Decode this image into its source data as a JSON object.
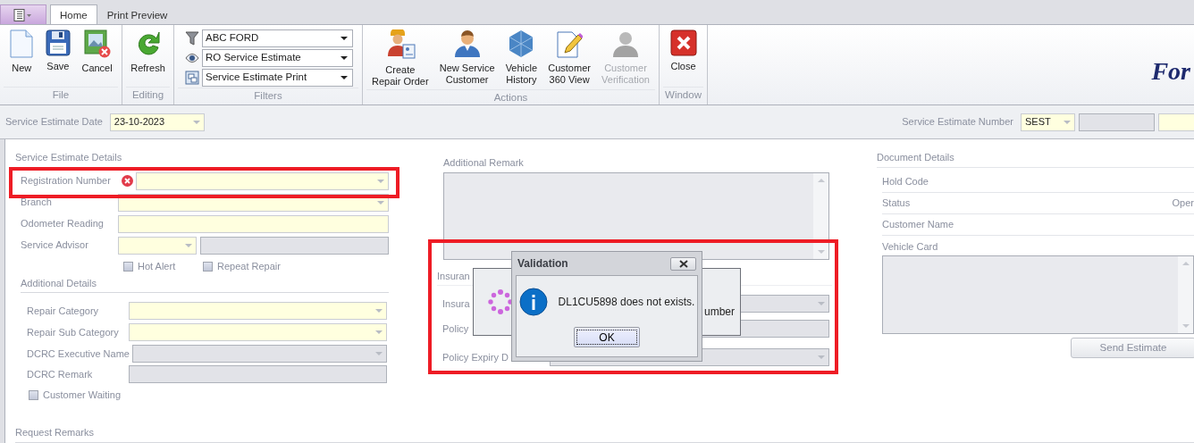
{
  "tabs": [
    {
      "label": "Home",
      "selected": true
    },
    {
      "label": "Print Preview",
      "selected": false
    }
  ],
  "ribbon": {
    "groups": [
      {
        "title": "File",
        "kind": "buttons",
        "buttons": [
          {
            "label": "New",
            "disabled": false
          },
          {
            "label": "Save",
            "disabled": false
          },
          {
            "label": "Cancel",
            "disabled": false
          }
        ]
      },
      {
        "title": "Editing",
        "kind": "buttons",
        "buttons": [
          {
            "label": "Refresh",
            "disabled": false
          }
        ]
      },
      {
        "title": "Filters",
        "kind": "filters",
        "dropdowns": [
          {
            "value": "ABC FORD"
          },
          {
            "value": "RO Service Estimate"
          },
          {
            "value": "Service Estimate Print"
          }
        ]
      },
      {
        "title": "Actions",
        "kind": "buttons",
        "buttons": [
          {
            "label": "Create\nRepair Order",
            "disabled": false
          },
          {
            "label": "New Service\nCustomer",
            "disabled": false
          },
          {
            "label": "Vehicle\nHistory",
            "disabled": false
          },
          {
            "label": "Customer\n360 View",
            "disabled": false
          },
          {
            "label": "Customer\nVerification",
            "disabled": true
          }
        ]
      },
      {
        "title": "Window",
        "kind": "buttons",
        "buttons": [
          {
            "label": "Close",
            "disabled": false
          }
        ]
      }
    ],
    "logo": "For"
  },
  "header_bar": {
    "date_label": "Service Estimate Date",
    "date_value": "23-10-2023",
    "number_label": "Service Estimate Number",
    "number_prefix": "SEST"
  },
  "service_estimate_details": {
    "title": "Service Estimate Details",
    "fields": [
      {
        "label": "Registration Number",
        "kind": "combo",
        "error": true,
        "disabled": false
      },
      {
        "label": "Branch",
        "kind": "combo",
        "error": false,
        "disabled": false
      },
      {
        "label": "Odometer Reading",
        "kind": "text",
        "error": false,
        "disabled": false
      },
      {
        "label": "Service Advisor",
        "kind": "combo_pair",
        "error": false,
        "disabled": false
      }
    ],
    "checkboxes": [
      {
        "label": "Hot Alert",
        "checked": false
      },
      {
        "label": "Repeat Repair",
        "checked": false
      }
    ]
  },
  "additional_details": {
    "title": "Additional Details",
    "fields": [
      {
        "label": "Repair Category",
        "kind": "combo",
        "error": false,
        "disabled": false
      },
      {
        "label": "Repair Sub Category",
        "kind": "combo",
        "error": false,
        "disabled": false
      },
      {
        "label": "DCRC Executive Name",
        "kind": "combo",
        "error": false,
        "disabled": true
      },
      {
        "label": "DCRC Remark",
        "kind": "text",
        "error": false,
        "disabled": true
      }
    ],
    "checkboxes": [
      {
        "label": "Customer Waiting",
        "checked": false
      }
    ]
  },
  "request_remarks": {
    "title": "Request Remarks"
  },
  "additional_remark": {
    "title": "Additional Remark"
  },
  "insurance": {
    "title": "Insuran",
    "fields": [
      {
        "label": "Insura",
        "kind": "combo",
        "disabled": true
      },
      {
        "label": "Policy",
        "kind": "text",
        "disabled": true
      },
      {
        "label": "Policy Expiry D",
        "kind": "combo",
        "disabled": true
      }
    ]
  },
  "document_details": {
    "title": "Document Details",
    "rows": [
      {
        "label": "Hold Code"
      },
      {
        "label": "Status",
        "value": "Oper"
      },
      {
        "label": "Customer Name"
      }
    ],
    "vehicle_card_label": "Vehicle Card",
    "send_button": "Send Estimate"
  },
  "loading_panel": {
    "text": "umber"
  },
  "dialog": {
    "title": "Validation",
    "message": "DL1CU5898 does not exists.",
    "ok_button": "OK"
  }
}
